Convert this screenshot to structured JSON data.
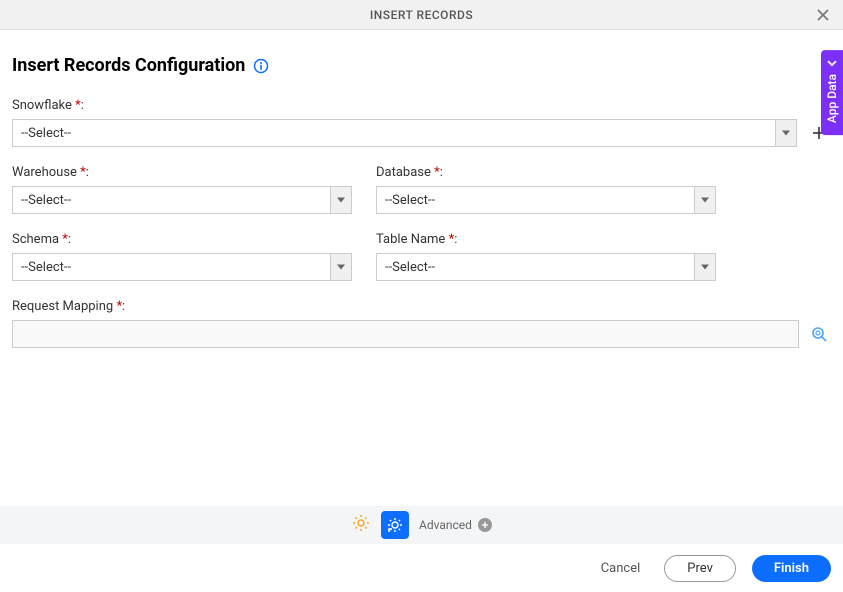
{
  "titlebar": {
    "title": "INSERT RECORDS"
  },
  "page": {
    "title": "Insert Records Configuration"
  },
  "fields": {
    "snowflake": {
      "label": "Snowflake",
      "value": "--Select--"
    },
    "warehouse": {
      "label": "Warehouse",
      "value": "--Select--"
    },
    "database": {
      "label": "Database",
      "value": "--Select--"
    },
    "schema": {
      "label": "Schema",
      "value": "--Select--"
    },
    "table": {
      "label": "Table Name",
      "value": "--Select--"
    },
    "mapping": {
      "label": "Request Mapping",
      "value": ""
    }
  },
  "sideTab": {
    "label": "App Data"
  },
  "footer": {
    "advanced": "Advanced"
  },
  "buttons": {
    "cancel": "Cancel",
    "prev": "Prev",
    "finish": "Finish"
  },
  "required_marker": "*",
  "colon": ":"
}
